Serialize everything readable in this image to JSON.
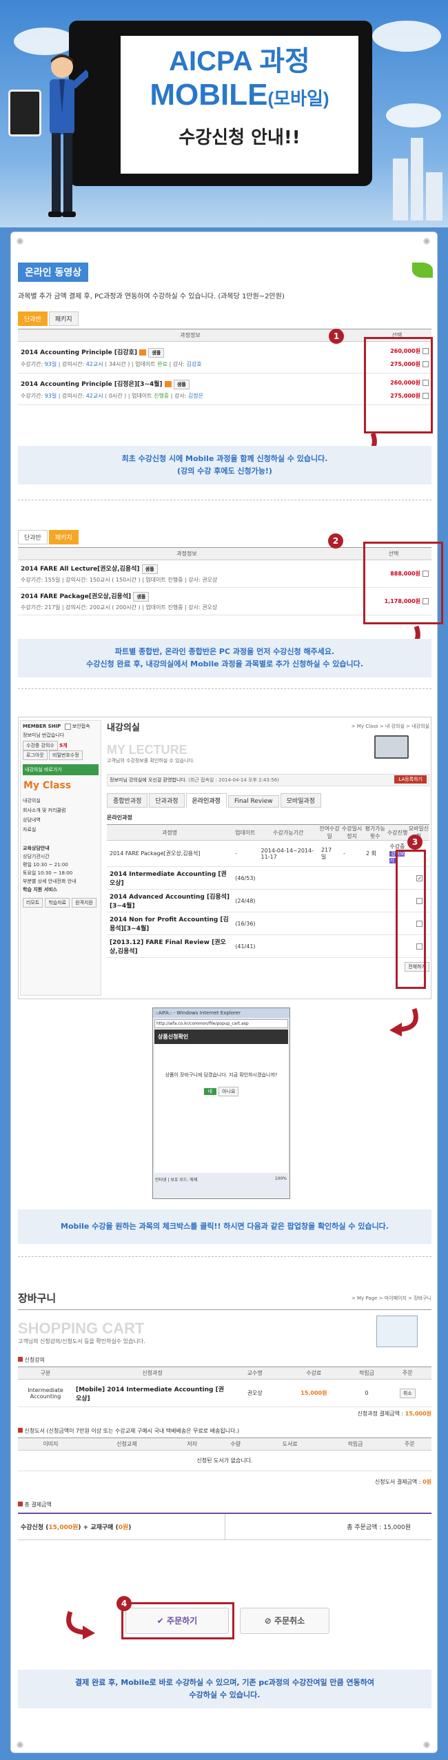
{
  "hero": {
    "line1": "AICPA 과정",
    "line2": "MOBILE",
    "line2_suffix": "(모바일)",
    "line3": "수강신청 안내!!"
  },
  "section1": {
    "title": "온라인 동영상",
    "desc": "과목별 추가 금액 결제 후, PC과정과 연동하여 수강하실 수 있습니다. (과목당 1만원~2만원)",
    "tabs": [
      "단과반",
      "패키지"
    ],
    "header_info": "과정정보",
    "header_select": "선택",
    "rows": [
      {
        "name": "2014 Accounting Principle [김강호]",
        "badge": "샘플",
        "meta_label": "수강기간:",
        "period": "93일",
        "lec_label": "강의시간:",
        "lec": "42교시",
        "hours": "( 34시간 )",
        "upd_label": "업데이트",
        "upd": "완료",
        "tch_label": "강사:",
        "teacher": "김강호",
        "p1": "260,000원",
        "p2": "275,000원"
      },
      {
        "name": "2014 Accounting Principle [김정은][3~4월]",
        "badge": "샘플",
        "meta_label": "수강기간:",
        "period": "93일",
        "lec_label": "강의시간:",
        "lec": "42교시",
        "hours": "( 0시간 )",
        "upd_label": "업데이트",
        "upd": "진행중",
        "tch_label": "강사:",
        "teacher": "김정은",
        "p1": "260,000원",
        "p2": "275,000원"
      }
    ],
    "note1": "최초 수강신청 시에 Mobile 과정을 함께 신청하실 수 있습니다.",
    "note2": "(강의 수강 후에도 신청가능!)"
  },
  "section2": {
    "tabs": [
      "단과반",
      "패키지"
    ],
    "header_info": "과정정보",
    "header_select": "선택",
    "rows": [
      {
        "name": "2014 FARE All Lecture[권오상,김용석]",
        "badge": "샘플",
        "meta": "수강기간: 155일 | 강의시간: 150교시 ( 150시간 ) | 업데이트 진행중 | 강사: 권오상",
        "price": "888,000원"
      },
      {
        "name": "2014 FARE Package[권오상,김용석]",
        "badge": "샘플",
        "meta": "수강기간: 217일 | 강의시간: 200교시 ( 200시간 ) | 업데이트 진행중 | 강사: 권오상",
        "price": "1,178,000원"
      }
    ],
    "note1": "파트별 종합반, 온라인 종합반은 PC 과정을 먼저 수강신청 해주세요.",
    "note2": "수강신청 완료 후, 내강의실에서 Mobile 과정을 과목별로 추가 신청하실 수 있습니다."
  },
  "section3": {
    "sidebar": {
      "membership": "MEMBER SHIP",
      "security": "보안접속",
      "greeting": "정보미님 반갑습니다",
      "menu": [
        "수강중 강의수",
        "5개",
        "로그아웃",
        "비밀번호수정"
      ],
      "my_lecture_btn": "내강의실 바로가기",
      "my_class": "My Class",
      "links": [
        "내강의실",
        "회사소개 및 커리큘럼",
        "상담내역",
        "자료실"
      ],
      "center": "교육상담안내",
      "phone_label": "상담기관시간",
      "time1": "평일 10:30 ~ 21:00",
      "time2": "토요일 10:30 ~ 18:00",
      "center2": "부분별 상세 안내전화 안내",
      "learn": "학습 지원 서비스",
      "svc": [
        "리모트",
        "학습자료",
        "원격지원"
      ]
    },
    "title": "내강의실",
    "breadcrumb": "> My Class > 내 강의실 > 내강의실",
    "heading": "MY LECTURE",
    "heading_sub": "고객님의 수강정보를 확인하실 수 있습니다.",
    "notice": "정보미님 강의실에 오신걸 환영합니다.",
    "notice_date": "(최근 접속일 : 2014-04-14 오후 2:43:56)",
    "la_btn": "LA등록하기",
    "tabs": [
      "종합반과정",
      "단과과정",
      "온라인과정",
      "Final Review",
      "모바일과정"
    ],
    "online": "온라인과정",
    "cols": [
      "과정명",
      "업데이트",
      "수강가능기간",
      "잔여수강일",
      "수강일시정지",
      "평가가능횟수",
      "수강진행",
      "모바일신청"
    ],
    "pkg": {
      "name": "2014 FARE Package[권오상,김용석]",
      "upd": "-",
      "period": "2014-04-14~2014-11-17",
      "days": "217 일",
      "pause": "-",
      "count": "2 회",
      "status1": "수강중",
      "status2": "강의보기"
    },
    "subs": [
      {
        "name": "2014 Intermediate Accounting [권오상]",
        "val": "(46/53)",
        "checked": "✓"
      },
      {
        "name": "2014 Advanced Accounting [김용석][3~4월]",
        "val": "(24/48)",
        "checked": ""
      },
      {
        "name": "2014 Non for Profit Accounting [김용석][3~4월]",
        "val": "(16/36)",
        "checked": ""
      },
      {
        "name": "[2013.12] FARE Final Review [권오상,김용석]",
        "val": "(41/41)",
        "checked": ""
      }
    ],
    "apply_btn": "전체하기"
  },
  "popup": {
    "window": "::AIFA:: - Windows Internet Explorer",
    "url": "http://aifa.co.kr/common/file/popup_cart.asp",
    "heading": "상품신청확인",
    "msg": "상품이 장바구니에 담겼습니다. 지금 확인하시겠습니까?",
    "yes": "네",
    "no": "아니요",
    "status": "인터넷 | 보호 모드: 해제",
    "zoom": "100%"
  },
  "note3": "Mobile 수강을 원하는 과목의 체크박스를 클릭!! 하시면 다음과 같은 팝업창을 확인하실 수 있습니다.",
  "cart": {
    "title": "장바구니",
    "breadcrumb": "> My Page > 마이페이지 > 장바구니",
    "heading": "SHOPPING CART",
    "sub": "고객님의 신청강의/신청도서 등을 확인하실수 있습니다.",
    "lec_title": "신청강의",
    "lec_cols": [
      "구분",
      "신청과정",
      "교수명",
      "수강료",
      "적립금",
      "주문"
    ],
    "lec_row": {
      "type": "Intermediate Accounting",
      "name": "[Mobile] 2014 Intermediate Accounting [권오상]",
      "prof": "권오상",
      "fee": "15,000원",
      "point": "0",
      "cancel": "취소"
    },
    "lec_total_label": "신청과정 결제금액 :",
    "lec_total": "15,000원",
    "book_title": "신청도서 (신청금액이 7만원 이상 또는 수강교재 구매시 국내 택배배송은 무료로 배송됩니다.)",
    "book_cols": [
      "이미지",
      "신청교재",
      "저자",
      "수량",
      "도서료",
      "적립금",
      "주문"
    ],
    "book_empty": "신청된 도서가 없습니다.",
    "book_total_label": "신청도서 결제금액 :",
    "book_total": "0원",
    "pay_title": "총 결제금액",
    "pay_left": "수강신청",
    "pay_left_val": "15,000원",
    "pay_plus": "+ 교재구매",
    "pay_book_val": "0원",
    "pay_right_label": "총 주문금액 :",
    "pay_right": "15,000원",
    "order_btn": "주문하기",
    "cancel_btn": "주문취소"
  },
  "note4_1": "결제 완료 후, Mobile로 바로 수강하실 수 있으며, 기존 pc과정의 수강잔여일 만큼 연동하여",
  "note4_2": "수강하실 수 있습니다.",
  "badges": [
    "1",
    "2",
    "3",
    "4"
  ],
  "colors": {
    "accent": "#3f86d4",
    "highlight": "#b01e2a",
    "price": "#d0021b"
  }
}
